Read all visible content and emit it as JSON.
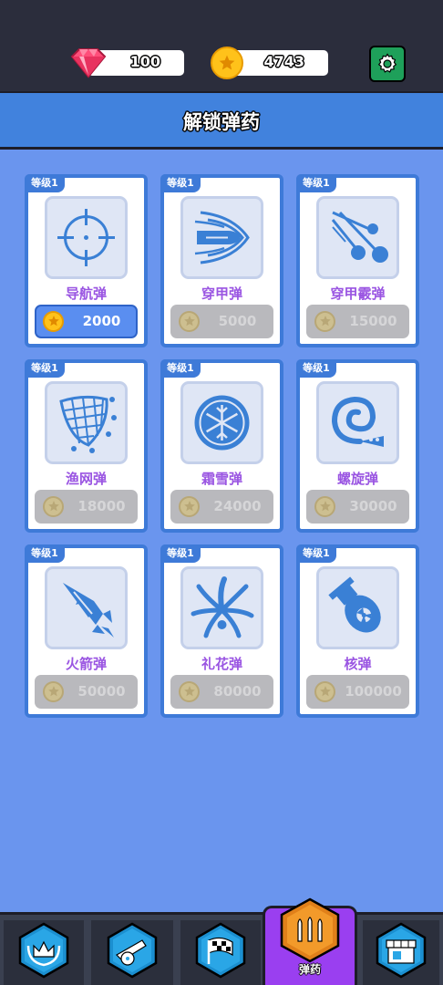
{
  "currency": {
    "gems": "100",
    "coins": "4743"
  },
  "header": {
    "title": "解锁弹药"
  },
  "ammo": [
    {
      "level": "等级1",
      "name": "导航弹",
      "price": "2000",
      "affordable": true,
      "icon": "crosshair-icon"
    },
    {
      "level": "等级1",
      "name": "穿甲弹",
      "price": "5000",
      "affordable": false,
      "icon": "piercing-bullet-icon"
    },
    {
      "level": "等级1",
      "name": "穿甲霰弹",
      "price": "15000",
      "affordable": false,
      "icon": "shotgun-pellets-icon"
    },
    {
      "level": "等级1",
      "name": "渔网弹",
      "price": "18000",
      "affordable": false,
      "icon": "net-icon"
    },
    {
      "level": "等级1",
      "name": "霜雪弹",
      "price": "24000",
      "affordable": false,
      "icon": "snowflake-icon"
    },
    {
      "level": "等级1",
      "name": "螺旋弹",
      "price": "30000",
      "affordable": false,
      "icon": "spiral-icon"
    },
    {
      "level": "等级1",
      "name": "火箭弹",
      "price": "50000",
      "affordable": false,
      "icon": "rocket-icon"
    },
    {
      "level": "等级1",
      "name": "礼花弹",
      "price": "80000",
      "affordable": false,
      "icon": "firework-icon"
    },
    {
      "level": "等级1",
      "name": "核弹",
      "price": "100000",
      "affordable": false,
      "icon": "nuke-icon"
    }
  ],
  "nav": {
    "tabs": [
      {
        "icon": "crown-laurel-icon"
      },
      {
        "icon": "cannon-icon"
      },
      {
        "icon": "checkered-flag-icon"
      },
      {
        "icon": "bullets-icon",
        "label": "弹药",
        "active": true
      },
      {
        "icon": "shop-icon"
      }
    ]
  },
  "colors": {
    "background": "#6a95ee",
    "card_border": "#3e7ad8",
    "name_text": "#9a55e2",
    "active_tab": "#9a3ff0",
    "coin": "#ffc21a"
  }
}
